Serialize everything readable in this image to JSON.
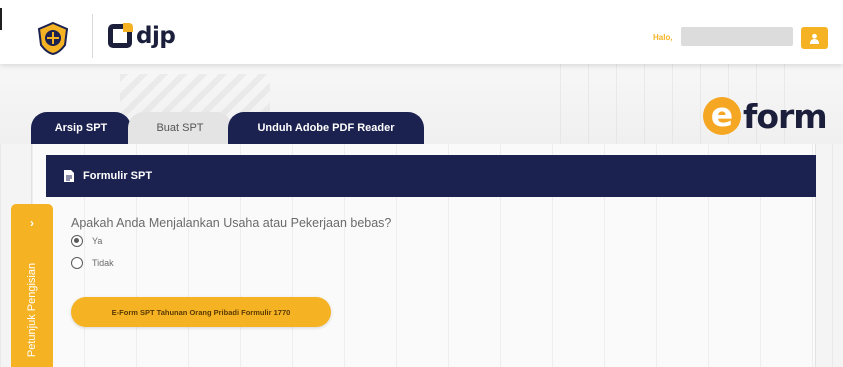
{
  "header": {
    "brand": "djp",
    "greeting_label": "Halo,"
  },
  "eform_logo": {
    "letter": "e",
    "word": "form"
  },
  "tabs": [
    {
      "label": "Arsip SPT"
    },
    {
      "label": "Buat SPT"
    },
    {
      "label": "Unduh Adobe PDF Reader"
    }
  ],
  "card": {
    "title": "Formulir SPT"
  },
  "form": {
    "question": "Apakah Anda Menjalankan Usaha atau Pekerjaan bebas?",
    "options": [
      {
        "label": "Ya",
        "selected": true
      },
      {
        "label": "Tidak",
        "selected": false
      }
    ],
    "button_label": "E-Form SPT Tahunan Orang Pribadi Formulir 1770"
  },
  "side_tab": {
    "chevron": "›",
    "label": "Petunjuk Pengisian"
  },
  "icons": {
    "emblem": "ministry-emblem-icon",
    "user": "user-icon",
    "document": "document-icon"
  },
  "colors": {
    "navy": "#1b2250",
    "accent": "#f5b324",
    "eform_orange": "#f5a623"
  }
}
